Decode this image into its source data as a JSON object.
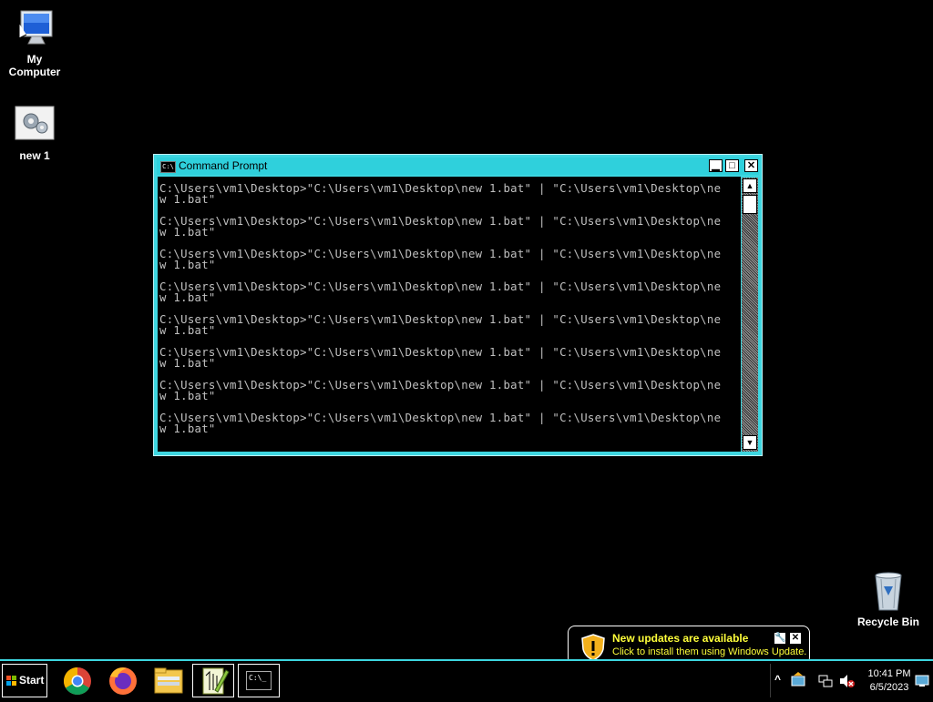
{
  "desktop": {
    "icons": [
      {
        "label": "My Computer"
      },
      {
        "label": "new 1"
      },
      {
        "label": "Recycle Bin"
      }
    ]
  },
  "cmd_window": {
    "title": "Command Prompt",
    "minimize_glyph": "▁",
    "maximize_glyph": "□",
    "close_glyph": "✕",
    "icon_text": "C:\\",
    "content": "C:\\Users\\vm1\\Desktop>\"C:\\Users\\vm1\\Desktop\\new 1.bat\" | \"C:\\Users\\vm1\\Desktop\\ne\nw 1.bat\"\n\nC:\\Users\\vm1\\Desktop>\"C:\\Users\\vm1\\Desktop\\new 1.bat\" | \"C:\\Users\\vm1\\Desktop\\ne\nw 1.bat\"\n\nC:\\Users\\vm1\\Desktop>\"C:\\Users\\vm1\\Desktop\\new 1.bat\" | \"C:\\Users\\vm1\\Desktop\\ne\nw 1.bat\"\n\nC:\\Users\\vm1\\Desktop>\"C:\\Users\\vm1\\Desktop\\new 1.bat\" | \"C:\\Users\\vm1\\Desktop\\ne\nw 1.bat\"\n\nC:\\Users\\vm1\\Desktop>\"C:\\Users\\vm1\\Desktop\\new 1.bat\" | \"C:\\Users\\vm1\\Desktop\\ne\nw 1.bat\"\n\nC:\\Users\\vm1\\Desktop>\"C:\\Users\\vm1\\Desktop\\new 1.bat\" | \"C:\\Users\\vm1\\Desktop\\ne\nw 1.bat\"\n\nC:\\Users\\vm1\\Desktop>\"C:\\Users\\vm1\\Desktop\\new 1.bat\" | \"C:\\Users\\vm1\\Desktop\\ne\nw 1.bat\"\n\nC:\\Users\\vm1\\Desktop>\"C:\\Users\\vm1\\Desktop\\new 1.bat\" | \"C:\\Users\\vm1\\Desktop\\ne\nw 1.bat\""
  },
  "notification": {
    "title": "New updates are available",
    "text": "Click to install them using Windows Update."
  },
  "taskbar": {
    "start_label": "Start",
    "apps": [
      "chrome-icon",
      "firefox-icon",
      "file-explorer-icon",
      "notepad-plus-plus-icon",
      "command-prompt-icon"
    ],
    "cmd_icon_text": "C:\\_",
    "tray_chevron": "^",
    "time": "10:41 PM",
    "date": "6/5/2023"
  },
  "colors": {
    "window_accent": "#3dd6e0",
    "notification_text": "#ffff3a",
    "desktop_bg": "#000000"
  }
}
